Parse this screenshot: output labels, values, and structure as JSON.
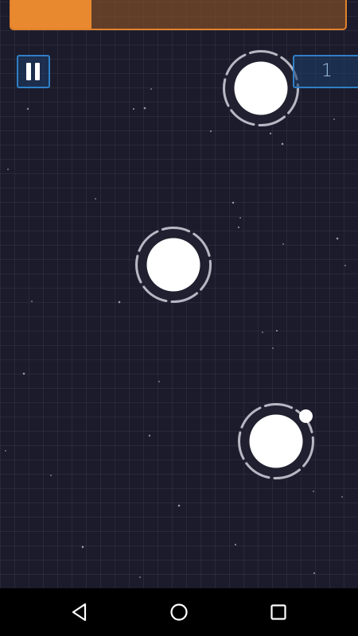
{
  "hud": {
    "progress_fraction": 0.24,
    "score": "1",
    "pause_icon": "pause-icon"
  },
  "colors": {
    "background": "#1b1b2b",
    "progress_border": "#e2812c",
    "progress_fill": "#e8892f",
    "ui_accent": "#2f7fc6",
    "planet": "#ffffff"
  },
  "nav_bar": {
    "icons": [
      "back-icon",
      "home-icon",
      "recent-apps-icon"
    ]
  }
}
